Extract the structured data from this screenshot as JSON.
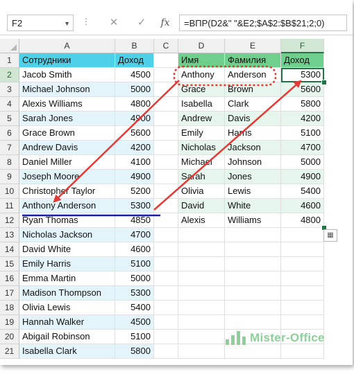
{
  "formula_bar": {
    "name_box": "F2",
    "cancel_icon": "✕",
    "enter_icon": "✓",
    "fx_label": "fx",
    "formula": "=ВПР(D2&\" \"&E2;$A$2:$B$21;2;0)"
  },
  "columns": [
    "A",
    "B",
    "C",
    "D",
    "E",
    "F"
  ],
  "rows": [
    "1",
    "2",
    "3",
    "4",
    "5",
    "6",
    "7",
    "8",
    "9",
    "10",
    "11",
    "12",
    "13",
    "14",
    "15",
    "16",
    "17",
    "18",
    "19",
    "20",
    "21"
  ],
  "left_table": {
    "header": [
      "Сотрудники",
      "Доход"
    ],
    "rows": [
      [
        "Jacob Smith",
        "4500"
      ],
      [
        "Michael Johnson",
        "5000"
      ],
      [
        "Alexis Williams",
        "4800"
      ],
      [
        "Sarah Jones",
        "4900"
      ],
      [
        "Grace Brown",
        "5600"
      ],
      [
        "Andrew Davis",
        "4200"
      ],
      [
        "Daniel Miller",
        "4100"
      ],
      [
        "Joseph Moore",
        "4900"
      ],
      [
        "Christopher Taylor",
        "5200"
      ],
      [
        "Anthony Anderson",
        "5300"
      ],
      [
        "Ryan Thomas",
        "4850"
      ],
      [
        "Nicholas Jackson",
        "4700"
      ],
      [
        "David White",
        "4600"
      ],
      [
        "Emily Harris",
        "5100"
      ],
      [
        "Emma Martin",
        "5000"
      ],
      [
        "Madison Thompson",
        "5300"
      ],
      [
        "Olivia Lewis",
        "5400"
      ],
      [
        "Hannah Walker",
        "4500"
      ],
      [
        "Abigail Robinson",
        "5100"
      ],
      [
        "Isabella Clark",
        "5800"
      ]
    ]
  },
  "right_table": {
    "header": [
      "Имя",
      "Фамилия",
      "Доход"
    ],
    "rows": [
      [
        "Anthony",
        "Anderson",
        "5300"
      ],
      [
        "Grace",
        "Brown",
        "5600"
      ],
      [
        "Isabella",
        "Clark",
        "5800"
      ],
      [
        "Andrew",
        "Davis",
        "4200"
      ],
      [
        "Emily",
        "Harris",
        "5100"
      ],
      [
        "Nicholas",
        "Jackson",
        "4700"
      ],
      [
        "Michael",
        "Johnson",
        "5000"
      ],
      [
        "Sarah",
        "Jones",
        "4900"
      ],
      [
        "Olivia",
        "Lewis",
        "5400"
      ],
      [
        "David",
        "White",
        "4600"
      ],
      [
        "Alexis",
        "Williams",
        "4800"
      ]
    ]
  },
  "selected_cell": "F2",
  "colors": {
    "left_header": "#4fd0e9",
    "right_header": "#6fcf8c",
    "arrow": "#e53935",
    "underline": "#1a1aa8",
    "selection": "#217346"
  },
  "watermark": {
    "text": "Mister-Office",
    "icon": "bar-chart-icon"
  }
}
